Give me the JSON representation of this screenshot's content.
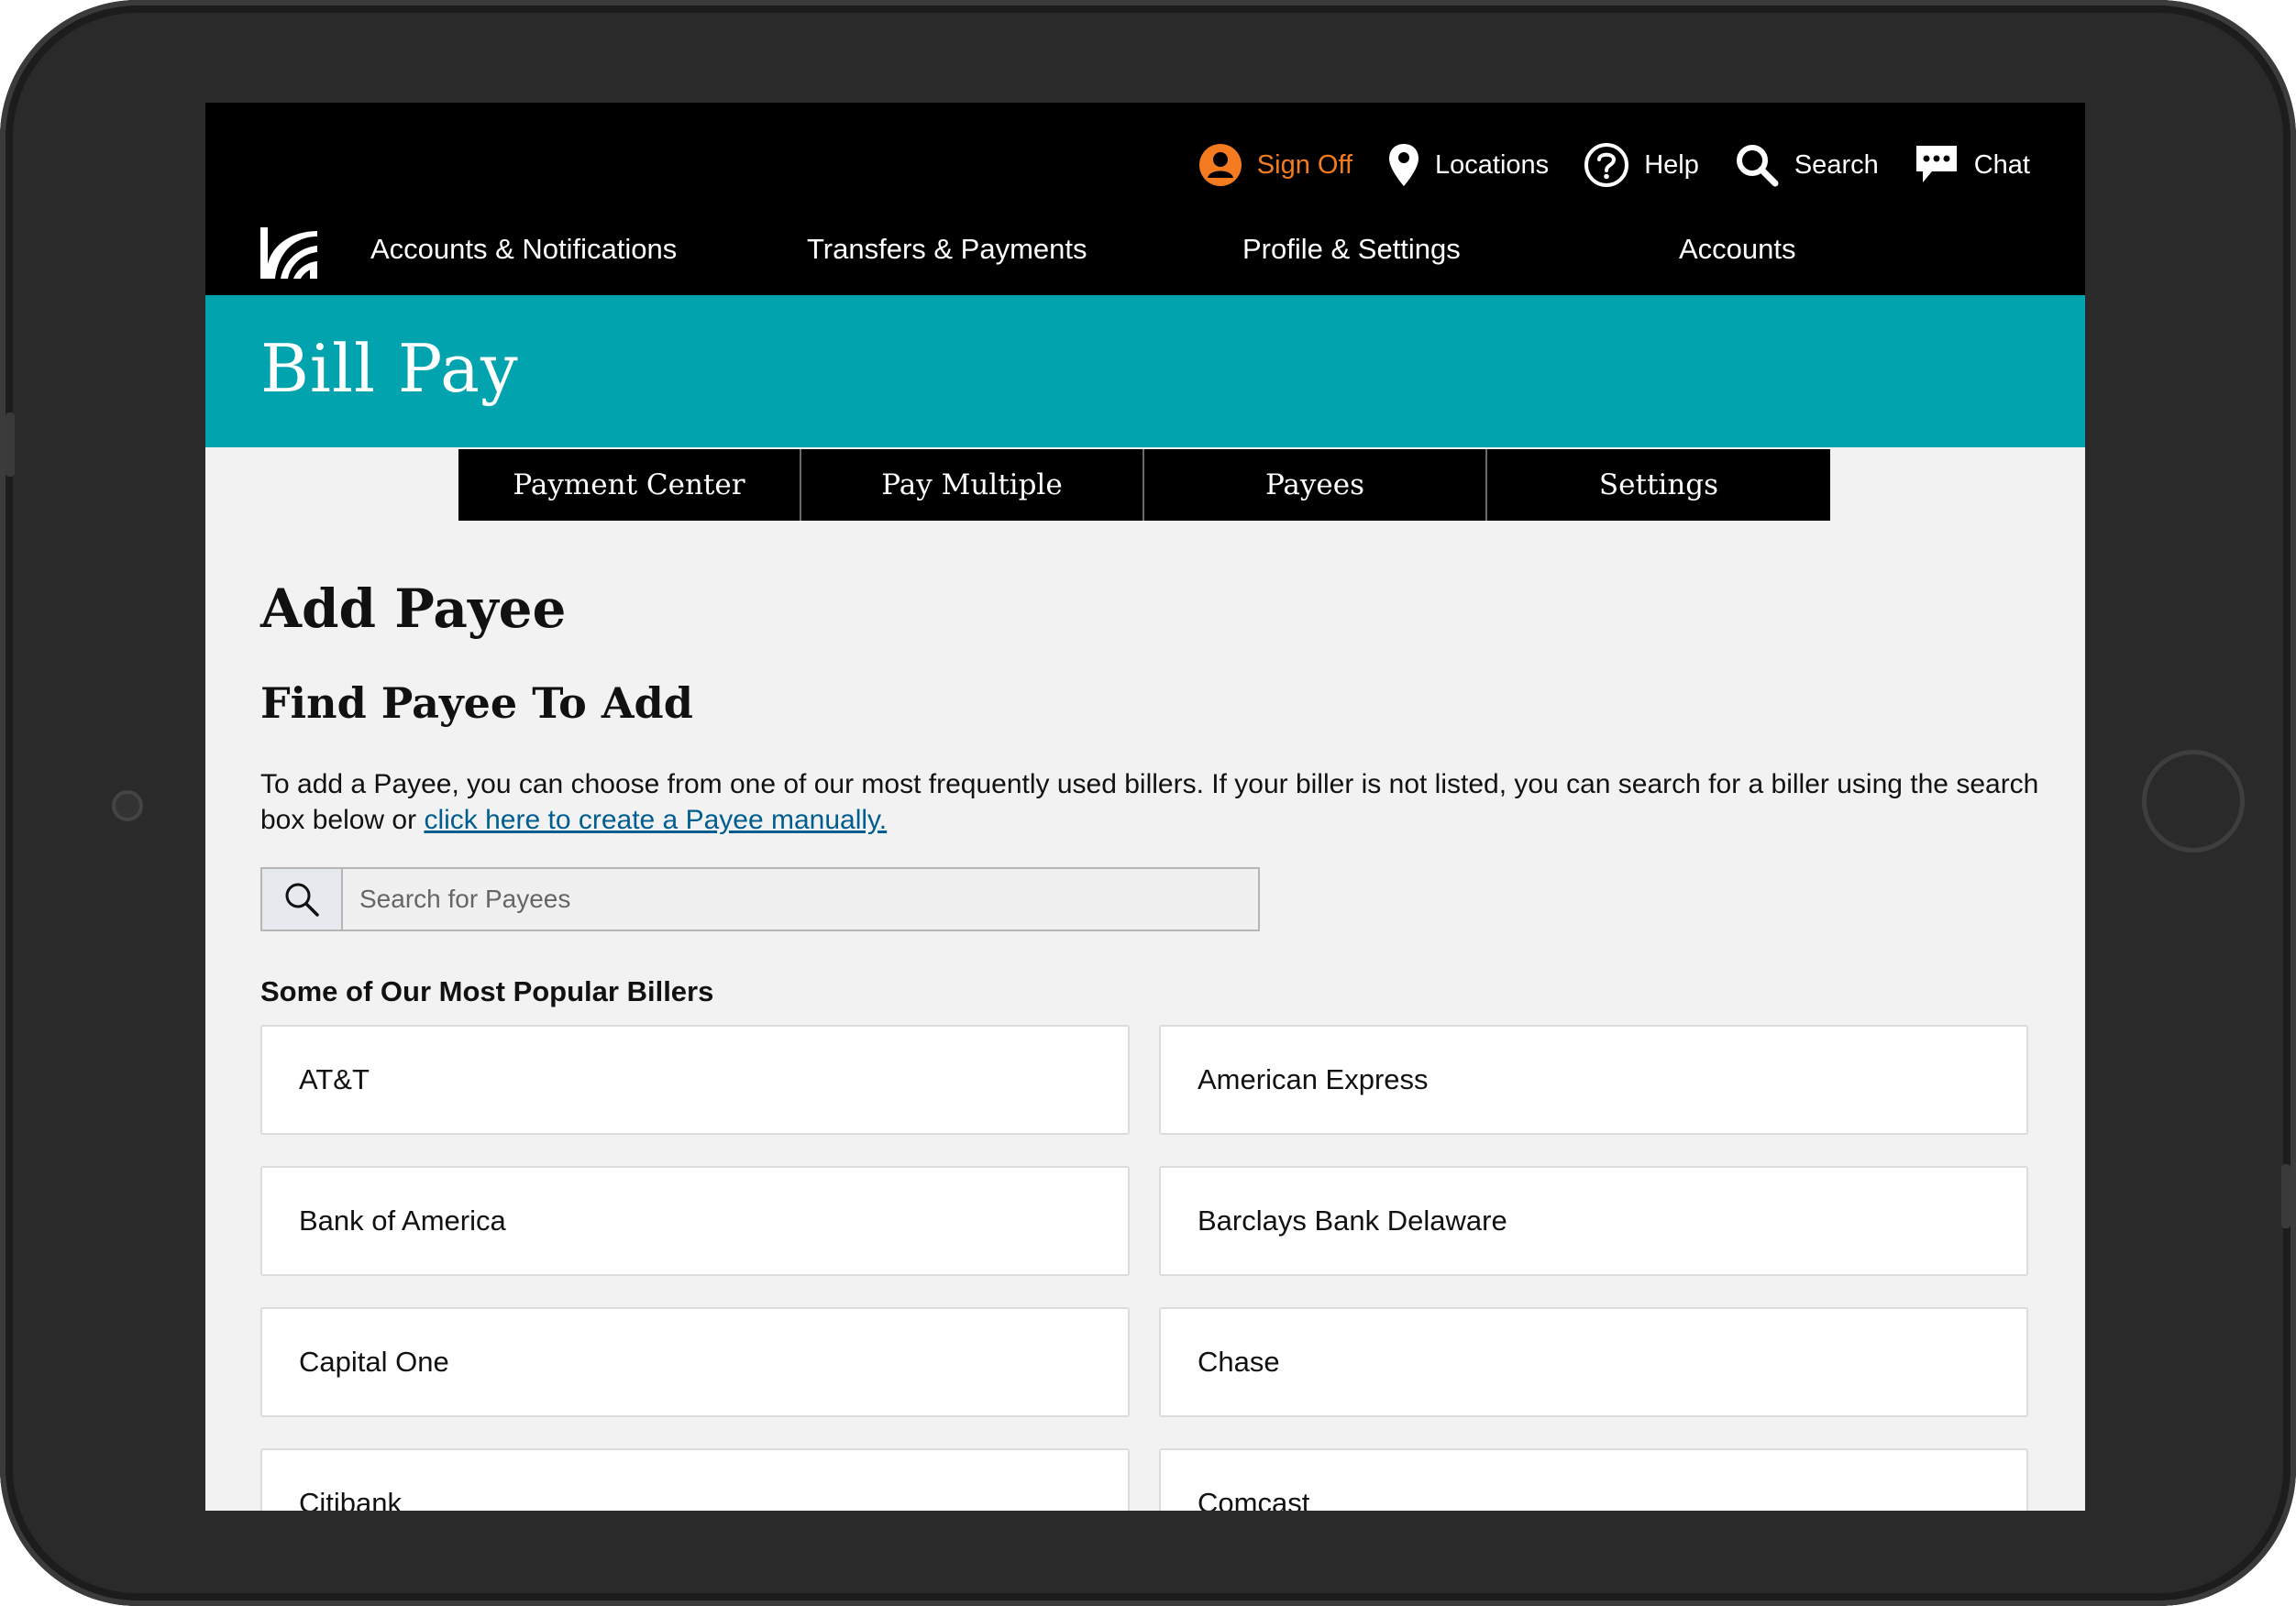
{
  "utility": {
    "sign_off": "Sign Off",
    "locations": "Locations",
    "help": "Help",
    "search": "Search",
    "chat": "Chat"
  },
  "nav": {
    "items": [
      {
        "label": "Accounts & Notifications"
      },
      {
        "label": "Transfers & Payments"
      },
      {
        "label": "Profile & Settings"
      },
      {
        "label": "Accounts"
      }
    ]
  },
  "banner": {
    "title": "Bill Pay"
  },
  "subtabs": [
    {
      "label": "Payment Center"
    },
    {
      "label": "Pay Multiple"
    },
    {
      "label": "Payees"
    },
    {
      "label": "Settings"
    }
  ],
  "main": {
    "page_title": "Add Payee",
    "section_title": "Find Payee To Add",
    "intro_text": "To add a Payee, you can choose from one of our most frequently used billers. If your biller is not listed, you can search for a biller using the search box below or ",
    "intro_link": "click here to create a Payee manually.",
    "search": {
      "placeholder": "Search for Payees",
      "value": ""
    },
    "popular_title": "Some of Our Most Popular Billers",
    "billers": [
      {
        "name": "AT&T"
      },
      {
        "name": "American Express"
      },
      {
        "name": "Bank of America"
      },
      {
        "name": "Barclays Bank Delaware"
      },
      {
        "name": "Capital One"
      },
      {
        "name": "Chase"
      },
      {
        "name": "Citibank"
      },
      {
        "name": "Comcast"
      }
    ]
  },
  "colors": {
    "header_bg": "#000000",
    "banner_teal": "#00a3ae",
    "sign_off_orange": "#f47b20",
    "link_blue": "#005d8f",
    "page_bg": "#f2f2f2"
  }
}
